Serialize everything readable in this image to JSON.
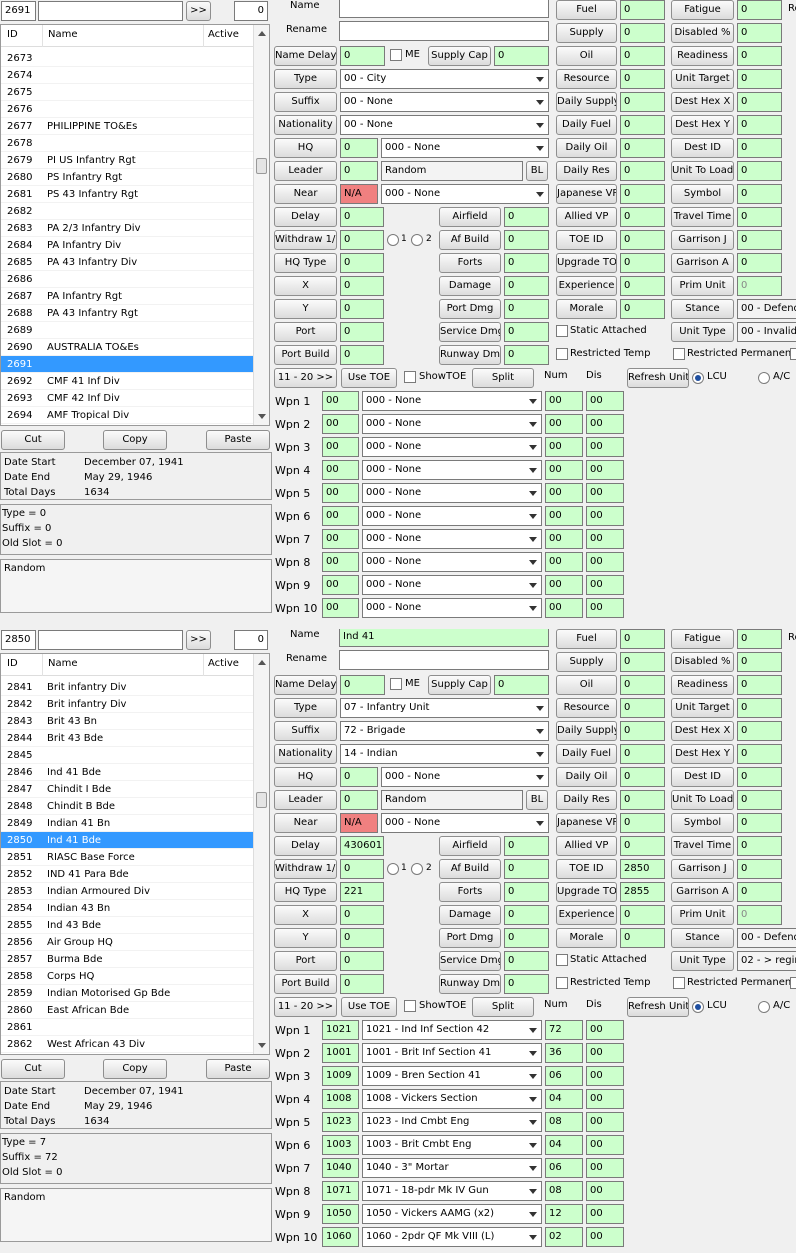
{
  "panels": [
    {
      "id_value": "2691",
      "search_value": "",
      "next_label": ">>",
      "count_value": "0",
      "list_headers": {
        "id": "ID",
        "name": "Name",
        "active": "Active"
      },
      "rows": [
        {
          "id": "2673",
          "name": ""
        },
        {
          "id": "2674",
          "name": ""
        },
        {
          "id": "2675",
          "name": ""
        },
        {
          "id": "2676",
          "name": ""
        },
        {
          "id": "2677",
          "name": "PHILIPPINE TO&Es"
        },
        {
          "id": "2678",
          "name": ""
        },
        {
          "id": "2679",
          "name": "PI US Infantry Rgt"
        },
        {
          "id": "2680",
          "name": "PS Infantry Rgt"
        },
        {
          "id": "2681",
          "name": "PS 43 Infantry Rgt"
        },
        {
          "id": "2682",
          "name": ""
        },
        {
          "id": "2683",
          "name": "PA 2/3 Infantry Div"
        },
        {
          "id": "2684",
          "name": "PA Infantry Div"
        },
        {
          "id": "2685",
          "name": "PA 43 Infantry Div"
        },
        {
          "id": "2686",
          "name": ""
        },
        {
          "id": "2687",
          "name": "PA Infantry Rgt"
        },
        {
          "id": "2688",
          "name": "PA 43 Infantry Rgt"
        },
        {
          "id": "2689",
          "name": ""
        },
        {
          "id": "2690",
          "name": "AUSTRALIA TO&Es"
        },
        {
          "id": "2691",
          "name": ""
        },
        {
          "id": "2692",
          "name": "CMF 41 Inf Div"
        },
        {
          "id": "2693",
          "name": "CMF 42 Inf Div"
        },
        {
          "id": "2694",
          "name": "AMF Tropical Div"
        }
      ],
      "selected_index": 18,
      "cut_label": "Cut",
      "copy_label": "Copy",
      "paste_label": "Paste",
      "date_start_label": "Date Start",
      "date_start": "December 07, 1941",
      "date_end_label": "Date End",
      "date_end": "May 29, 1946",
      "total_days_label": "Total Days",
      "total_days": "1634",
      "type_info": "Type = 0",
      "suffix_info": "Suffix = 0",
      "old_slot_info": "Old Slot = 0",
      "notes": "Random",
      "form": {
        "name_label": "Name",
        "name_value": "",
        "rename_label": "Rename",
        "rename_value": "",
        "name_delay_label": "Name Delay",
        "name_delay_value": "0",
        "me_label": "ME",
        "supply_cap_label": "Supply Cap",
        "supply_cap_value": "0",
        "type_label": "Type",
        "type_value": "00 - City",
        "suffix_label": "Suffix",
        "suffix_value": "00 - None",
        "nationality_label": "Nationality",
        "nationality_value": "00 - None",
        "hq_label": "HQ",
        "hq_value": "0",
        "hq_select": "000 - None",
        "leader_label": "Leader",
        "leader_value": "0",
        "leader_name": "Random",
        "bl_label": "BL",
        "near_label": "Near",
        "near_value": "N/A",
        "near_select": "000 - None",
        "delay_label": "Delay",
        "delay_value": "0",
        "withdraw_label": "Withdraw 1/2",
        "withdraw_value": "0",
        "radio1": "1",
        "radio2": "2",
        "hq_type_label": "HQ Type",
        "hq_type_value": "0",
        "x_label": "X",
        "x_value": "0",
        "y_label": "Y",
        "y_value": "0",
        "port_label": "Port",
        "port_value": "0",
        "port_build_label": "Port Build",
        "port_build_value": "0",
        "airfield_label": "Airfield",
        "airfield_value": "0",
        "af_build_label": "Af Build",
        "af_build_value": "0",
        "forts_label": "Forts",
        "forts_value": "0",
        "damage_label": "Damage",
        "damage_value": "0",
        "port_dmg_label": "Port Dmg",
        "port_dmg_value": "0",
        "service_dmg_label": "Service Dmg",
        "service_dmg_value": "0",
        "runway_dmg_label": "Runway Dmg",
        "runway_dmg_value": "0",
        "fuel_label": "Fuel",
        "fuel_value": "0",
        "supply_label": "Supply",
        "supply_value": "0",
        "oil_label": "Oil",
        "oil_value": "0",
        "resource_label": "Resource",
        "resource_value": "0",
        "daily_supply_label": "Daily Supply",
        "daily_supply_value": "0",
        "daily_fuel_label": "Daily Fuel",
        "daily_fuel_value": "0",
        "daily_oil_label": "Daily Oil",
        "daily_oil_value": "0",
        "daily_res_label": "Daily Res",
        "daily_res_value": "0",
        "japanese_vp_label": "Japanese VP",
        "japanese_vp_value": "0",
        "allied_vp_label": "Allied VP",
        "allied_vp_value": "0",
        "toe_id_label": "TOE ID",
        "toe_id_value": "0",
        "upgrade_toe_label": "Upgrade TOE",
        "upgrade_toe_value": "0",
        "experience_label": "Experience",
        "experience_value": "0",
        "morale_label": "Morale",
        "morale_value": "0",
        "static_attached_label": "Static Attached",
        "restricted_temp_label": "Restricted Temp",
        "fatigue_label": "Fatigue",
        "fatigue_value": "0",
        "disabled_label": "Disabled %",
        "disabled_value": "0",
        "readiness_label": "Readiness",
        "readiness_value": "0",
        "unit_target_label": "Unit Target",
        "unit_target_value": "0",
        "dest_hex_x_label": "Dest Hex X",
        "dest_hex_x_value": "0",
        "dest_hex_y_label": "Dest Hex Y",
        "dest_hex_y_value": "0",
        "dest_id_label": "Dest ID",
        "dest_id_value": "0",
        "unit_to_load_label": "Unit To Load",
        "unit_to_load_value": "0",
        "symbol_label": "Symbol",
        "symbol_value": "0",
        "travel_time_label": "Travel Time",
        "travel_time_value": "0",
        "garrison_j_label": "Garrison J",
        "garrison_j_value": "0",
        "garrison_a_label": "Garrison A",
        "garrison_a_value": "0",
        "prim_unit_label": "Prim Unit",
        "prim_unit_value": "0",
        "stance_label": "Stance",
        "stance_value": "00 - Defend",
        "unit_type_label": "Unit Type",
        "unit_type_value": "00 - Invalid",
        "restricted_permanent_label": "Restricted Permanent",
        "edge_label": "Re",
        "page_label": "11 - 20 >>",
        "use_toe_label": "Use TOE",
        "show_toe_label": "ShowTOE",
        "split_label": "Split",
        "num_label": "Num",
        "dis_label": "Dis",
        "refresh_label": "Refresh Units",
        "lcu_label": "LCU",
        "ac_label": "A/C"
      },
      "weapons": [
        {
          "label": "Wpn 1",
          "code": "00",
          "name": "000 - None",
          "num": "00",
          "dis": "00"
        },
        {
          "label": "Wpn 2",
          "code": "00",
          "name": "000 - None",
          "num": "00",
          "dis": "00"
        },
        {
          "label": "Wpn 3",
          "code": "00",
          "name": "000 - None",
          "num": "00",
          "dis": "00"
        },
        {
          "label": "Wpn 4",
          "code": "00",
          "name": "000 - None",
          "num": "00",
          "dis": "00"
        },
        {
          "label": "Wpn 5",
          "code": "00",
          "name": "000 - None",
          "num": "00",
          "dis": "00"
        },
        {
          "label": "Wpn 6",
          "code": "00",
          "name": "000 - None",
          "num": "00",
          "dis": "00"
        },
        {
          "label": "Wpn 7",
          "code": "00",
          "name": "000 - None",
          "num": "00",
          "dis": "00"
        },
        {
          "label": "Wpn 8",
          "code": "00",
          "name": "000 - None",
          "num": "00",
          "dis": "00"
        },
        {
          "label": "Wpn 9",
          "code": "00",
          "name": "000 - None",
          "num": "00",
          "dis": "00"
        },
        {
          "label": "Wpn 10",
          "code": "00",
          "name": "000 - None",
          "num": "00",
          "dis": "00"
        }
      ]
    },
    {
      "id_value": "2850",
      "search_value": "",
      "next_label": ">>",
      "count_value": "0",
      "list_headers": {
        "id": "ID",
        "name": "Name",
        "active": "Active"
      },
      "rows": [
        {
          "id": "2841",
          "name": "Brit infantry Div"
        },
        {
          "id": "2842",
          "name": "Brit infantry Div"
        },
        {
          "id": "2843",
          "name": "Brit 43 Bn"
        },
        {
          "id": "2844",
          "name": "Brit 43 Bde"
        },
        {
          "id": "2845",
          "name": ""
        },
        {
          "id": "2846",
          "name": "Ind 41 Bde"
        },
        {
          "id": "2847",
          "name": "Chindit I Bde"
        },
        {
          "id": "2848",
          "name": "Chindit B Bde"
        },
        {
          "id": "2849",
          "name": "Indian 41 Bn"
        },
        {
          "id": "2850",
          "name": "Ind 41 Bde"
        },
        {
          "id": "2851",
          "name": "RIASC Base Force"
        },
        {
          "id": "2852",
          "name": "IND 41 Para Bde"
        },
        {
          "id": "2853",
          "name": "Indian Armoured Div"
        },
        {
          "id": "2854",
          "name": "Indian 43 Bn"
        },
        {
          "id": "2855",
          "name": "Ind 43 Bde"
        },
        {
          "id": "2856",
          "name": "Air Group HQ"
        },
        {
          "id": "2857",
          "name": "Burma Bde"
        },
        {
          "id": "2858",
          "name": "Corps HQ"
        },
        {
          "id": "2859",
          "name": "Indian Motorised Gp Bde"
        },
        {
          "id": "2860",
          "name": "East African Bde"
        },
        {
          "id": "2861",
          "name": ""
        },
        {
          "id": "2862",
          "name": "West African 43 Div"
        }
      ],
      "selected_index": 9,
      "cut_label": "Cut",
      "copy_label": "Copy",
      "paste_label": "Paste",
      "date_start_label": "Date Start",
      "date_start": "December 07, 1941",
      "date_end_label": "Date End",
      "date_end": "May 29, 1946",
      "total_days_label": "Total Days",
      "total_days": "1634",
      "type_info": "Type = 7",
      "suffix_info": "Suffix = 72",
      "old_slot_info": "Old Slot = 0",
      "notes": "Random",
      "form": {
        "name_label": "Name",
        "name_value": "Ind 41",
        "rename_label": "Rename",
        "rename_value": "",
        "name_delay_label": "Name Delay",
        "name_delay_value": "0",
        "me_label": "ME",
        "supply_cap_label": "Supply Cap",
        "supply_cap_value": "0",
        "type_label": "Type",
        "type_value": "07 - Infantry Unit",
        "suffix_label": "Suffix",
        "suffix_value": "72 - Brigade",
        "nationality_label": "Nationality",
        "nationality_value": "14 - Indian",
        "hq_label": "HQ",
        "hq_value": "0",
        "hq_select": "000 - None",
        "leader_label": "Leader",
        "leader_value": "0",
        "leader_name": "Random",
        "bl_label": "BL",
        "near_label": "Near",
        "near_value": "N/A",
        "near_select": "000 - None",
        "delay_label": "Delay",
        "delay_value": "430601",
        "withdraw_label": "Withdraw 1/2",
        "withdraw_value": "0",
        "radio1": "1",
        "radio2": "2",
        "hq_type_label": "HQ Type",
        "hq_type_value": "221",
        "x_label": "X",
        "x_value": "0",
        "y_label": "Y",
        "y_value": "0",
        "port_label": "Port",
        "port_value": "0",
        "port_build_label": "Port Build",
        "port_build_value": "0",
        "airfield_label": "Airfield",
        "airfield_value": "0",
        "af_build_label": "Af Build",
        "af_build_value": "0",
        "forts_label": "Forts",
        "forts_value": "0",
        "damage_label": "Damage",
        "damage_value": "0",
        "port_dmg_label": "Port Dmg",
        "port_dmg_value": "0",
        "service_dmg_label": "Service Dmg",
        "service_dmg_value": "0",
        "runway_dmg_label": "Runway Dmg",
        "runway_dmg_value": "0",
        "fuel_label": "Fuel",
        "fuel_value": "0",
        "supply_label": "Supply",
        "supply_value": "0",
        "oil_label": "Oil",
        "oil_value": "0",
        "resource_label": "Resource",
        "resource_value": "0",
        "daily_supply_label": "Daily Supply",
        "daily_supply_value": "0",
        "daily_fuel_label": "Daily Fuel",
        "daily_fuel_value": "0",
        "daily_oil_label": "Daily Oil",
        "daily_oil_value": "0",
        "daily_res_label": "Daily Res",
        "daily_res_value": "0",
        "japanese_vp_label": "Japanese VP",
        "japanese_vp_value": "0",
        "allied_vp_label": "Allied VP",
        "allied_vp_value": "0",
        "toe_id_label": "TOE ID",
        "toe_id_value": "2850",
        "upgrade_toe_label": "Upgrade TOE",
        "upgrade_toe_value": "2855",
        "experience_label": "Experience",
        "experience_value": "0",
        "morale_label": "Morale",
        "morale_value": "0",
        "static_attached_label": "Static Attached",
        "restricted_temp_label": "Restricted Temp",
        "fatigue_label": "Fatigue",
        "fatigue_value": "0",
        "disabled_label": "Disabled %",
        "disabled_value": "0",
        "readiness_label": "Readiness",
        "readiness_value": "0",
        "unit_target_label": "Unit Target",
        "unit_target_value": "0",
        "dest_hex_x_label": "Dest Hex X",
        "dest_hex_x_value": "0",
        "dest_hex_y_label": "Dest Hex Y",
        "dest_hex_y_value": "0",
        "dest_id_label": "Dest ID",
        "dest_id_value": "0",
        "unit_to_load_label": "Unit To Load",
        "unit_to_load_value": "0",
        "symbol_label": "Symbol",
        "symbol_value": "0",
        "travel_time_label": "Travel Time",
        "travel_time_value": "0",
        "garrison_j_label": "Garrison J",
        "garrison_j_value": "0",
        "garrison_a_label": "Garrison A",
        "garrison_a_value": "0",
        "prim_unit_label": "Prim Unit",
        "prim_unit_value": "0",
        "stance_label": "Stance",
        "stance_value": "00 - Defend",
        "unit_type_label": "Unit Type",
        "unit_type_value": "02 - > regim",
        "restricted_permanent_label": "Restricted Permanent",
        "edge_label": "Re",
        "page_label": "11 - 20 >>",
        "use_toe_label": "Use TOE",
        "show_toe_label": "ShowTOE",
        "split_label": "Split",
        "num_label": "Num",
        "dis_label": "Dis",
        "refresh_label": "Refresh Units",
        "lcu_label": "LCU",
        "ac_label": "A/C"
      },
      "weapons": [
        {
          "label": "Wpn 1",
          "code": "1021",
          "name": "1021 - Ind Inf Section 42",
          "num": "72",
          "dis": "00"
        },
        {
          "label": "Wpn 2",
          "code": "1001",
          "name": "1001 - Brit Inf Section 41",
          "num": "36",
          "dis": "00"
        },
        {
          "label": "Wpn 3",
          "code": "1009",
          "name": "1009 - Bren Section 41",
          "num": "06",
          "dis": "00"
        },
        {
          "label": "Wpn 4",
          "code": "1008",
          "name": "1008 - Vickers Section",
          "num": "04",
          "dis": "00"
        },
        {
          "label": "Wpn 5",
          "code": "1023",
          "name": "1023 - Ind Cmbt Eng",
          "num": "08",
          "dis": "00"
        },
        {
          "label": "Wpn 6",
          "code": "1003",
          "name": "1003 - Brit Cmbt Eng",
          "num": "04",
          "dis": "00"
        },
        {
          "label": "Wpn 7",
          "code": "1040",
          "name": "1040 - 3\" Mortar",
          "num": "06",
          "dis": "00"
        },
        {
          "label": "Wpn 8",
          "code": "1071",
          "name": "1071 - 18-pdr Mk IV Gun",
          "num": "08",
          "dis": "00"
        },
        {
          "label": "Wpn 9",
          "code": "1050",
          "name": "1050 - Vickers AAMG (x2)",
          "num": "12",
          "dis": "00"
        },
        {
          "label": "Wpn 10",
          "code": "1060",
          "name": "1060 - 2pdr QF Mk VIII (L)",
          "num": "02",
          "dis": "00"
        }
      ]
    }
  ]
}
